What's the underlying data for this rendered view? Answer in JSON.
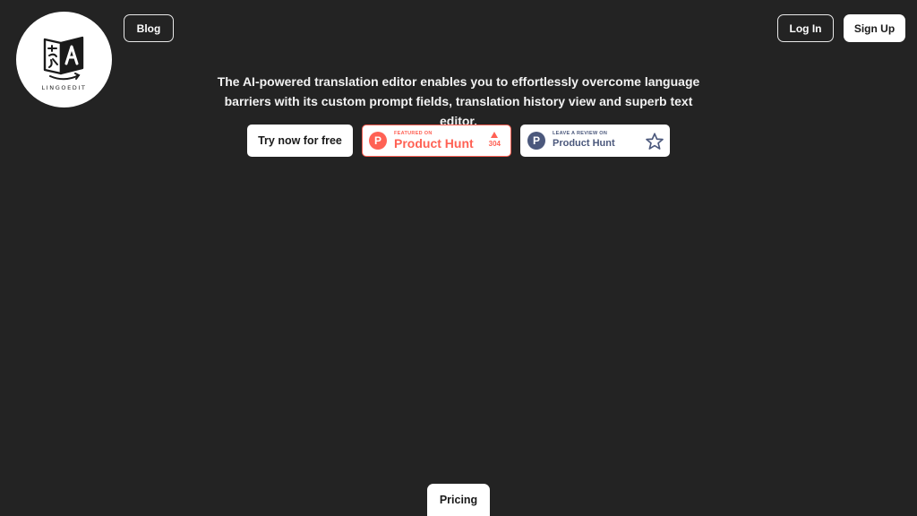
{
  "brand": {
    "name": "LINGOEDIT",
    "logo_icon": "translate-book-icon"
  },
  "nav": {
    "blog_label": "Blog",
    "login_label": "Log In",
    "signup_label": "Sign Up"
  },
  "hero": {
    "tagline_line1": "The AI-powered translation editor enables you to effortlessly overcome language",
    "tagline_line2": "barriers with its custom prompt fields, translation history view and superb text editor."
  },
  "cta": {
    "try_label": "Try now for free"
  },
  "badges": {
    "featured": {
      "small_text": "FEATURED ON",
      "big_text": "Product Hunt",
      "votes": "304",
      "logo_letter": "P",
      "color": "#ff6154"
    },
    "review": {
      "small_text": "LEAVE A REVIEW ON",
      "big_text": "Product Hunt",
      "logo_letter": "P",
      "color": "#4b587c"
    }
  },
  "footer": {
    "pricing_label": "Pricing"
  },
  "colors": {
    "background": "#232323",
    "text": "#ffffff"
  }
}
